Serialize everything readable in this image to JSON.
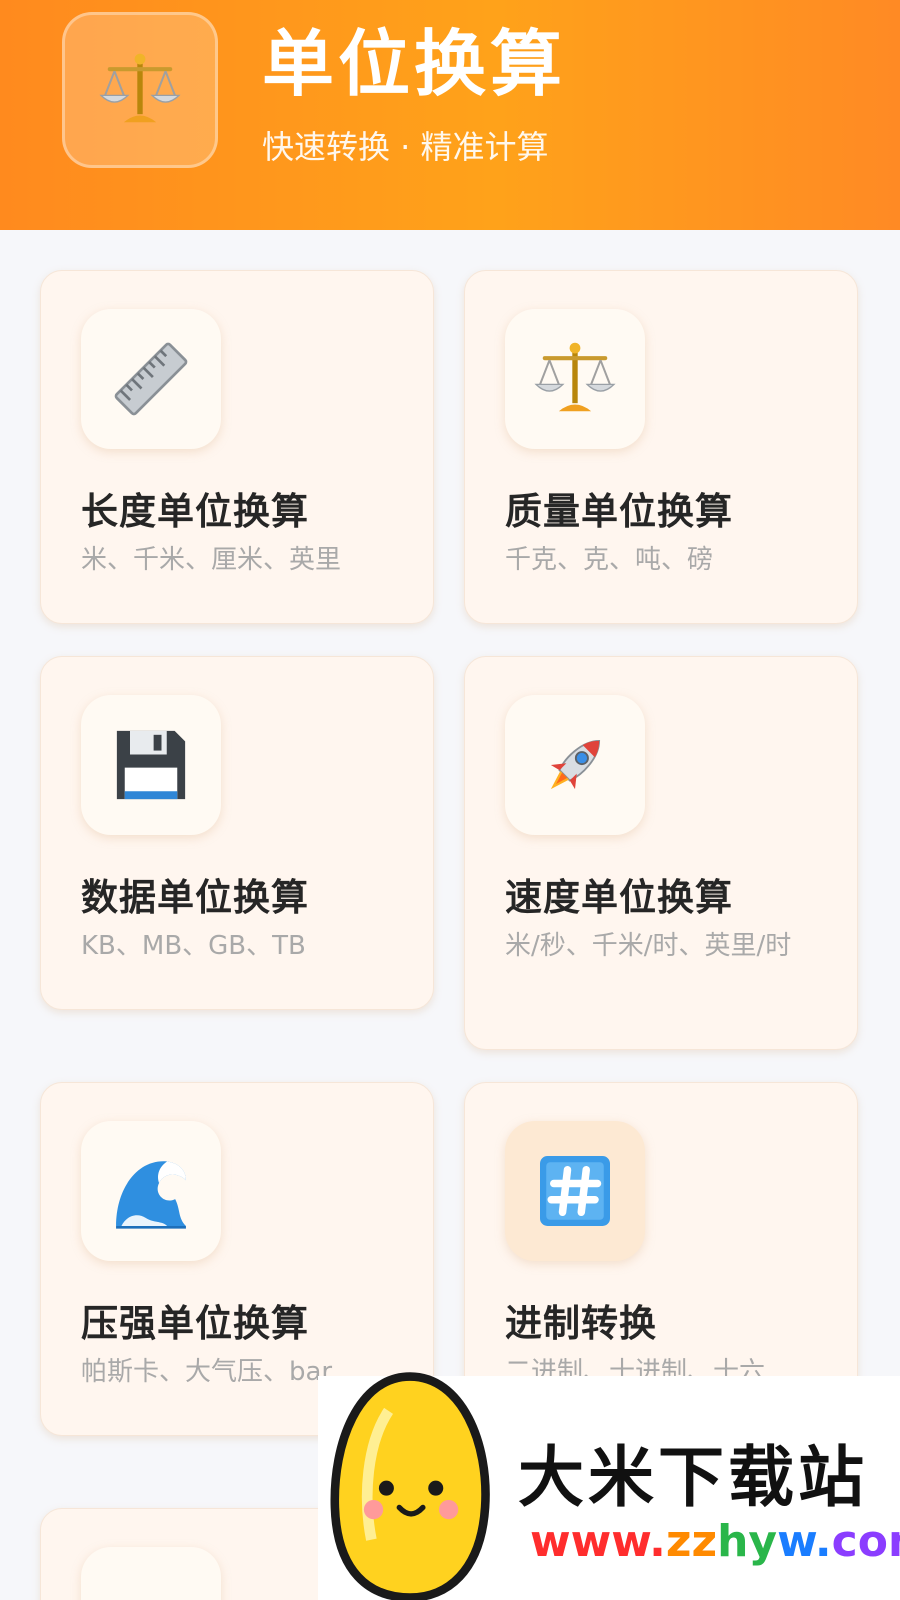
{
  "header": {
    "title": "单位换算",
    "subtitle": "快速转换 · 精准计算",
    "icon": "scales-icon"
  },
  "cards": [
    {
      "title": "长度单位换算",
      "desc": "米、千米、厘米、英里",
      "icon": "ruler-icon"
    },
    {
      "title": "质量单位换算",
      "desc": "千克、克、吨、磅",
      "icon": "scales-icon"
    },
    {
      "title": "数据单位换算",
      "desc": "KB、MB、GB、TB",
      "icon": "floppy-disk-icon"
    },
    {
      "title": "速度单位换算",
      "desc": "米/秒、千米/时、英里/时",
      "icon": "rocket-icon"
    },
    {
      "title": "压强单位换算",
      "desc": "帕斯卡、大气压、bar",
      "icon": "wave-icon"
    },
    {
      "title": "进制转换",
      "desc": "二进制、十进制、十六",
      "icon": "hash-icon"
    }
  ],
  "watermark": {
    "name": "大米下载站",
    "url_parts": [
      "www.",
      "zz",
      "hy",
      "w.",
      "com"
    ]
  },
  "colors": {
    "header_start": "#ff8a1e",
    "header_end": "#ffa21a",
    "card_bg": "#fff6ef",
    "title": "#262626",
    "desc": "#a9a9a9"
  }
}
